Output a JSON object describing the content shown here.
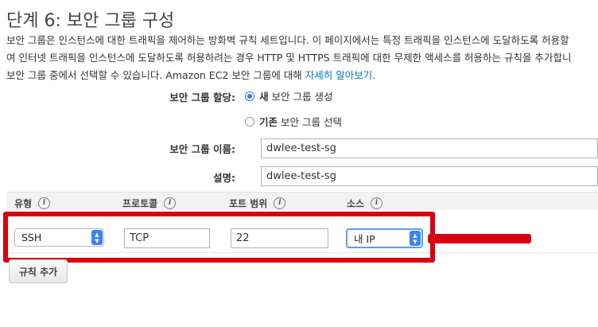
{
  "page": {
    "title": "단계 6: 보안 그룹 구성",
    "description_lines": [
      "보안 그룹은 인스턴스에 대한 트래픽을 제어하는 방화벽 규칙 세트입니다. 이 페이지에서는 특정 트래픽을 인스턴스에 도달하도록 허용할",
      "여 인터넷 트래픽을 인스턴스에 도달하도록 허용하려는 경우 HTTP 및 HTTPS 트래픽에 대한 무제한 액세스를 허용하는 규칙을 추가합니",
      "보안 그룹 중에서 선택할 수 있습니다. Amazon EC2 보안 그룹에 대해 "
    ],
    "learn_more_link": "자세히 알아보기",
    "description_end": "."
  },
  "assign": {
    "label": "보안 그룹 할당:",
    "option_new_bold": "새",
    "option_new_rest": "보안 그룹 생성",
    "option_existing_bold": "기존",
    "option_existing_rest": "보안 그룹 선택",
    "selected": "new"
  },
  "fields": {
    "name_label": "보안 그룹 이름:",
    "name_value": "dwlee-test-sg",
    "desc_label": "설명:",
    "desc_value": "dwlee-test-sg"
  },
  "table": {
    "headers": [
      "유형",
      "프로토콜",
      "포트 범위",
      "소스"
    ],
    "info_icon": "i",
    "row": {
      "type": "SSH",
      "protocol": "TCP",
      "port_range": "22",
      "source": "내 IP"
    }
  },
  "add_rule_button": "규칙 추가",
  "colors": {
    "annotation_red": "#d90011",
    "link_blue": "#0073bb",
    "radio_blue": "#2f7ce0"
  }
}
